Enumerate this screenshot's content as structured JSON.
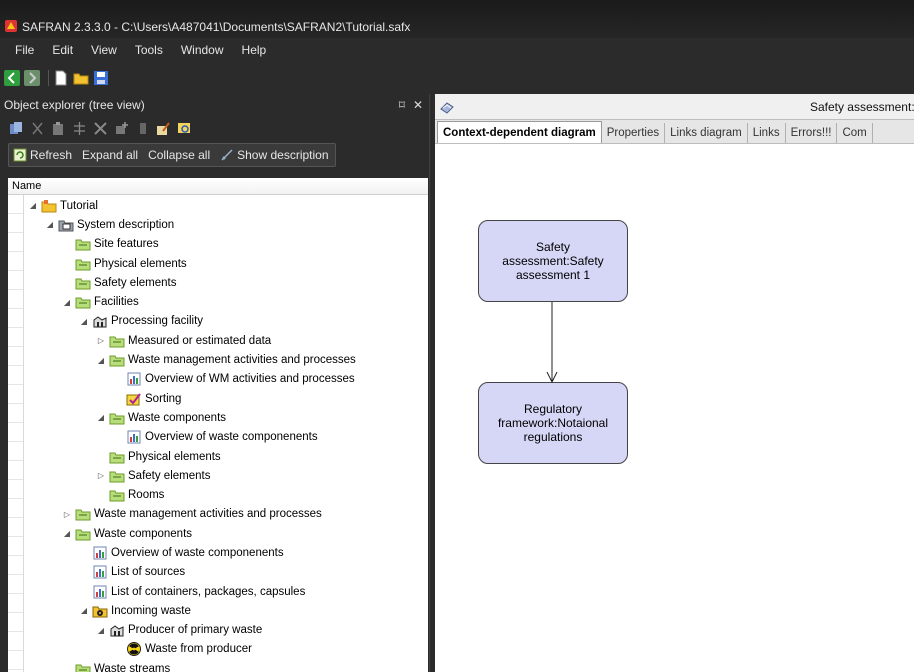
{
  "window": {
    "title": "SAFRAN 2.3.3.0 - C:\\Users\\A487041\\Documents\\SAFRAN2\\Tutorial.safx"
  },
  "menu": [
    "File",
    "Edit",
    "View",
    "Tools",
    "Window",
    "Help"
  ],
  "left_pane": {
    "title": "Object explorer (tree view)",
    "pin": "⌑",
    "close": "✕",
    "actions": {
      "refresh": "Refresh",
      "expand_all": "Expand all",
      "collapse_all": "Collapse all",
      "show_description": "Show description"
    },
    "column_header": "Name"
  },
  "tree": [
    {
      "label": "Tutorial",
      "level": 0,
      "expander": "expanded",
      "icon": "folder-project-icon"
    },
    {
      "label": "System description",
      "level": 1,
      "expander": "expanded",
      "icon": "system-description-icon"
    },
    {
      "label": "Site features",
      "level": 2,
      "expander": "none",
      "icon": "folder-green-icon"
    },
    {
      "label": "Physical elements",
      "level": 2,
      "expander": "none",
      "icon": "folder-green-icon"
    },
    {
      "label": "Safety elements",
      "level": 2,
      "expander": "none",
      "icon": "folder-green-icon"
    },
    {
      "label": "Facilities",
      "level": 2,
      "expander": "expanded",
      "icon": "folder-green-icon"
    },
    {
      "label": "Processing facility",
      "level": 3,
      "expander": "expanded",
      "icon": "facility-icon"
    },
    {
      "label": "Measured or estimated data",
      "level": 4,
      "expander": "collapsed",
      "icon": "folder-green-icon"
    },
    {
      "label": "Waste management activities and processes",
      "level": 4,
      "expander": "expanded",
      "icon": "folder-green-icon"
    },
    {
      "label": "Overview of WM activities and processes",
      "level": 5,
      "expander": "none",
      "icon": "chart-table-icon"
    },
    {
      "label": "Sorting",
      "level": 5,
      "expander": "none",
      "icon": "process-icon"
    },
    {
      "label": "Waste components",
      "level": 4,
      "expander": "expanded",
      "icon": "folder-green-icon"
    },
    {
      "label": "Overview of waste componenents",
      "level": 5,
      "expander": "none",
      "icon": "chart-table-icon"
    },
    {
      "label": "Physical elements",
      "level": 4,
      "expander": "none",
      "icon": "folder-green-icon"
    },
    {
      "label": "Safety elements",
      "level": 4,
      "expander": "collapsed",
      "icon": "folder-green-icon"
    },
    {
      "label": "Rooms",
      "level": 4,
      "expander": "none",
      "icon": "folder-green-icon"
    },
    {
      "label": "Waste management activities and processes",
      "level": 2,
      "expander": "collapsed",
      "icon": "folder-green-icon"
    },
    {
      "label": "Waste components",
      "level": 2,
      "expander": "expanded",
      "icon": "folder-green-icon"
    },
    {
      "label": "Overview of waste componenents",
      "level": 3,
      "expander": "none",
      "icon": "chart-table-icon"
    },
    {
      "label": "List of sources",
      "level": 3,
      "expander": "none",
      "icon": "chart-table-icon"
    },
    {
      "label": "List of containers, packages, capsules",
      "level": 3,
      "expander": "none",
      "icon": "chart-table-icon"
    },
    {
      "label": "Incoming waste",
      "level": 3,
      "expander": "expanded",
      "icon": "radioactive-folder-icon"
    },
    {
      "label": "Producer of primary waste",
      "level": 4,
      "expander": "expanded",
      "icon": "facility-icon"
    },
    {
      "label": "Waste from producer",
      "level": 5,
      "expander": "none",
      "icon": "radioactive-icon"
    },
    {
      "label": "Waste streams",
      "level": 2,
      "expander": "none",
      "icon": "folder-green-icon"
    }
  ],
  "right_pane": {
    "doc_title": "Safety assessment: S",
    "tabs": [
      {
        "label": "Context-dependent diagram",
        "active": true
      },
      {
        "label": "Properties",
        "active": false
      },
      {
        "label": "Links diagram",
        "active": false
      },
      {
        "label": "Links",
        "active": false
      },
      {
        "label": "Errors!!!",
        "active": false
      },
      {
        "label": "Com",
        "active": false
      }
    ],
    "diagram": {
      "nodes": [
        {
          "text": "Safety assessment:Safety assessment 1"
        },
        {
          "text": "Regulatory framework:Notaional regulations"
        }
      ]
    }
  },
  "colors": {
    "chrome": "#2b2b2b",
    "node_fill": "#d6d6f7",
    "folder_green": "#8cc63f"
  }
}
